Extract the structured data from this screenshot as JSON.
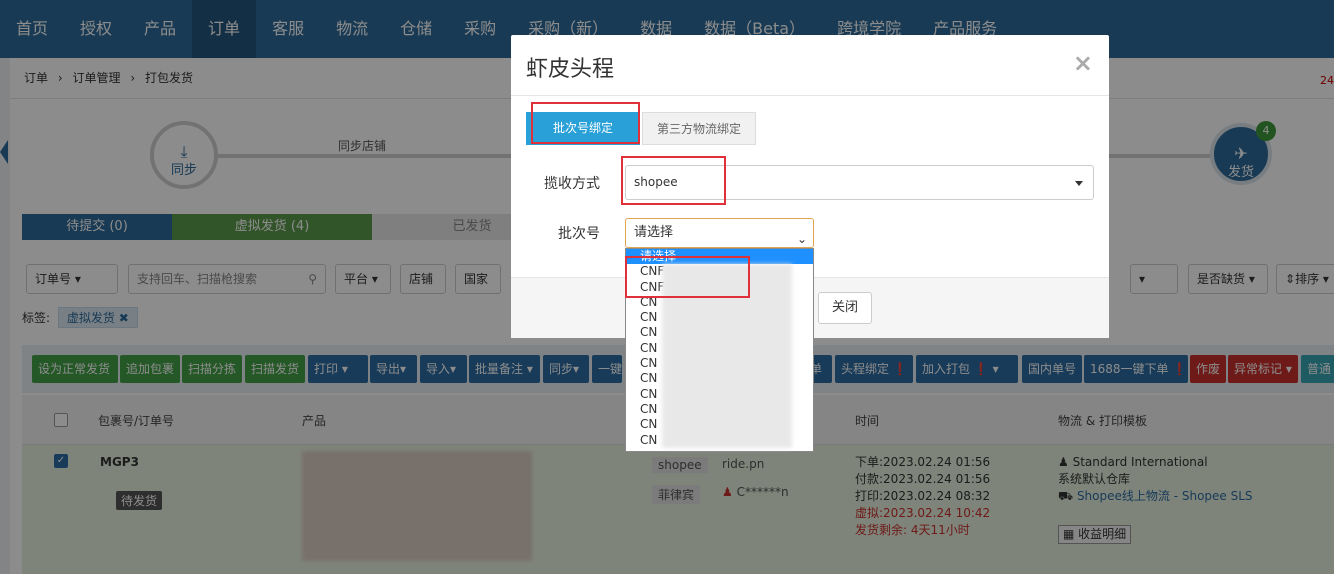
{
  "nav": {
    "items": [
      "首页",
      "授权",
      "产品",
      "订单",
      "客服",
      "物流",
      "仓储",
      "采购",
      "采购（新）",
      "数据",
      "数据（Beta）",
      "跨境学院",
      "产品服务"
    ],
    "active_index": 3
  },
  "breadcrumb": {
    "items": [
      "订单",
      "订单管理",
      "打包发货"
    ],
    "separator": "›"
  },
  "top_right_text": "24",
  "steps": {
    "sync_label": "同步",
    "sync_store_label": "同步店铺",
    "ship_label": "发货",
    "ship_badge": "4"
  },
  "status_tabs": [
    "待提交 (0)",
    "虚拟发货 (4)",
    "已发货"
  ],
  "filters": {
    "order_no": "订单号",
    "search_placeholder": "支持回车、扫描枪搜索",
    "platform": "平台",
    "store": "店铺",
    "country": "国家",
    "out_of_stock": "是否缺货",
    "sort": "排序"
  },
  "tags": {
    "label": "标签:",
    "chip": "虚拟发货",
    "chip_close": "✖"
  },
  "actions": [
    "设为正常发货",
    "追加包裹",
    "扫描分拣",
    "扫描发货",
    "打印",
    "导出",
    "导入",
    "批量备注",
    "同步",
    "一键",
    "单",
    "头程绑定",
    "加入打包",
    "国内单号",
    "1688一键下单",
    "作废",
    "异常标记",
    "普通"
  ],
  "table": {
    "headers": [
      "包裹号/订单号",
      "产品",
      "时间",
      "物流 & 打印模板"
    ]
  },
  "order": {
    "package_no": "MGP3",
    "status": "待发货",
    "platform": "shopee",
    "store": "ride.pn",
    "country": "菲律宾",
    "buyer": "C******n",
    "times": [
      "下单:2023.02.24 01:56",
      "付款:2023.02.24 01:56",
      "打印:2023.02.24 08:32",
      "虚拟:2023.02.24 10:42",
      "发货剩余: 4天11小时"
    ],
    "logistics": [
      "Standard International",
      "系统默认仓库",
      "Shopee线上物流 - Shopee SLS"
    ],
    "income_btn": "收益明细"
  },
  "modal": {
    "title": "虾皮头程",
    "close": "×",
    "tabs": [
      "批次号绑定",
      "第三方物流绑定"
    ],
    "pickup_label": "揽收方式",
    "pickup_value": "shopee",
    "batch_label": "批次号",
    "batch_value": "请选择",
    "close_btn": "关闭",
    "options": [
      "请选择",
      "CNF",
      "CNF",
      "CN",
      "CN",
      "CN",
      "CN",
      "CN",
      "CN",
      "CN",
      "CN",
      "CN",
      "CN"
    ]
  }
}
